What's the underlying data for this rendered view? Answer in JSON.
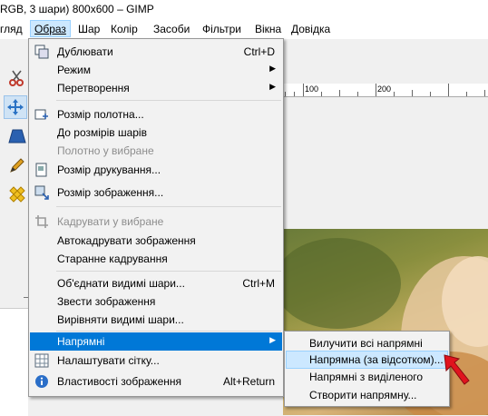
{
  "window": {
    "title": "RGB, 3 шари) 800x600 – GIMP"
  },
  "menubar": {
    "items": [
      {
        "label": "гляд",
        "x": 0
      },
      {
        "label": "Образ",
        "active": true
      },
      {
        "label": "Шар"
      },
      {
        "label": "Колір"
      },
      {
        "label": "Засоби"
      },
      {
        "label": "Фільтри"
      },
      {
        "label": "Вікна"
      },
      {
        "label": "Довідка"
      }
    ]
  },
  "ruler": {
    "label_100": "100",
    "label_200": "200"
  },
  "image_menu": {
    "items": [
      {
        "label": "Дублювати",
        "shortcut": "Ctrl+D",
        "icon": "duplicate-icon"
      },
      {
        "label": "Режим",
        "submenu": true
      },
      {
        "label": "Перетворення",
        "submenu": true
      },
      {
        "label": "Розмір полотна...",
        "icon": "canvas-size-icon"
      },
      {
        "label": "До розмірів шарів"
      },
      {
        "label": "Полотно у вибране",
        "disabled": true
      },
      {
        "label": "Розмір друкування...",
        "icon": "print-size-icon"
      },
      {
        "label": "Розмір зображення...",
        "icon": "scale-image-icon"
      },
      {
        "label": "Кадрувати у вибране",
        "disabled": true,
        "icon": "crop-icon"
      },
      {
        "label": "Автокадрувати зображення"
      },
      {
        "label": "Старанне кадрування"
      },
      {
        "label": "Об'єднати видимі шари...",
        "shortcut": "Ctrl+M"
      },
      {
        "label": "Звести зображення"
      },
      {
        "label": "Вирівняти видимі шари..."
      },
      {
        "label": "Напрямні",
        "submenu": true,
        "highlighted": true
      },
      {
        "label": "Налаштувати сітку...",
        "icon": "grid-icon"
      },
      {
        "label": "Властивості зображення",
        "shortcut": "Alt+Return",
        "icon": "info-icon"
      }
    ]
  },
  "guides_submenu": {
    "items": [
      {
        "label": "Вилучити всі напрямні"
      },
      {
        "label": "Напрямна (за відсотком)...",
        "hovered": true
      },
      {
        "label": "Напрямні з виділеного"
      },
      {
        "label": "Створити напрямну..."
      }
    ]
  },
  "colors": {
    "highlight": "#0078d7",
    "hover": "#cce8ff",
    "cursor": "#e0141e"
  }
}
